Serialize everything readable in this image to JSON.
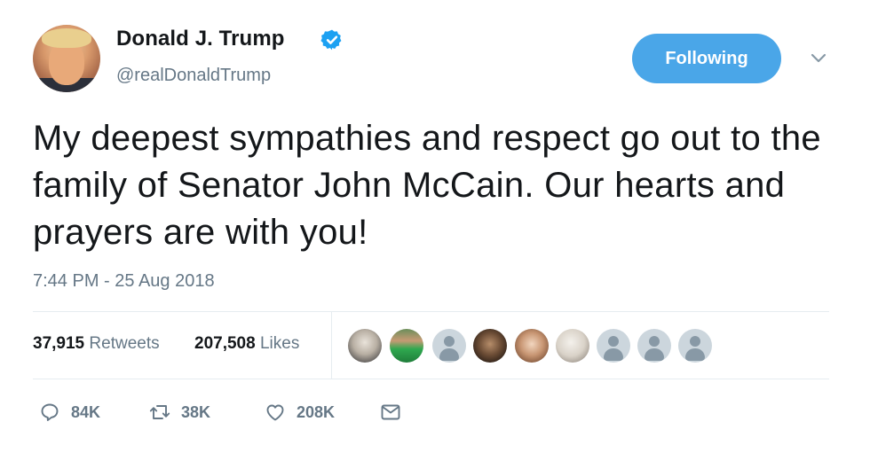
{
  "author": {
    "display_name": "Donald J. Trump",
    "handle": "@realDonaldTrump",
    "verified": true
  },
  "follow_button": {
    "label": "Following"
  },
  "tweet": {
    "text": "My deepest sympathies and respect go out to the family of Senator John McCain. Our hearts and prayers are with you!",
    "timestamp": "7:44 PM - 25 Aug 2018"
  },
  "stats": {
    "retweets_count": "37,915",
    "retweets_label": "Retweets",
    "likes_count": "207,508",
    "likes_label": "Likes"
  },
  "liker_avatars": [
    "photo",
    "photo",
    "default",
    "photo",
    "photo",
    "photo",
    "default",
    "default",
    "default"
  ],
  "actions": {
    "reply_count": "84K",
    "retweet_count": "38K",
    "like_count": "208K"
  },
  "colors": {
    "accent": "#4aa6e8",
    "verified": "#1da1f2",
    "muted": "#657786"
  },
  "icons": [
    "verified-badge-icon",
    "chevron-down-icon",
    "reply-icon",
    "retweet-icon",
    "like-icon",
    "direct-message-icon"
  ]
}
